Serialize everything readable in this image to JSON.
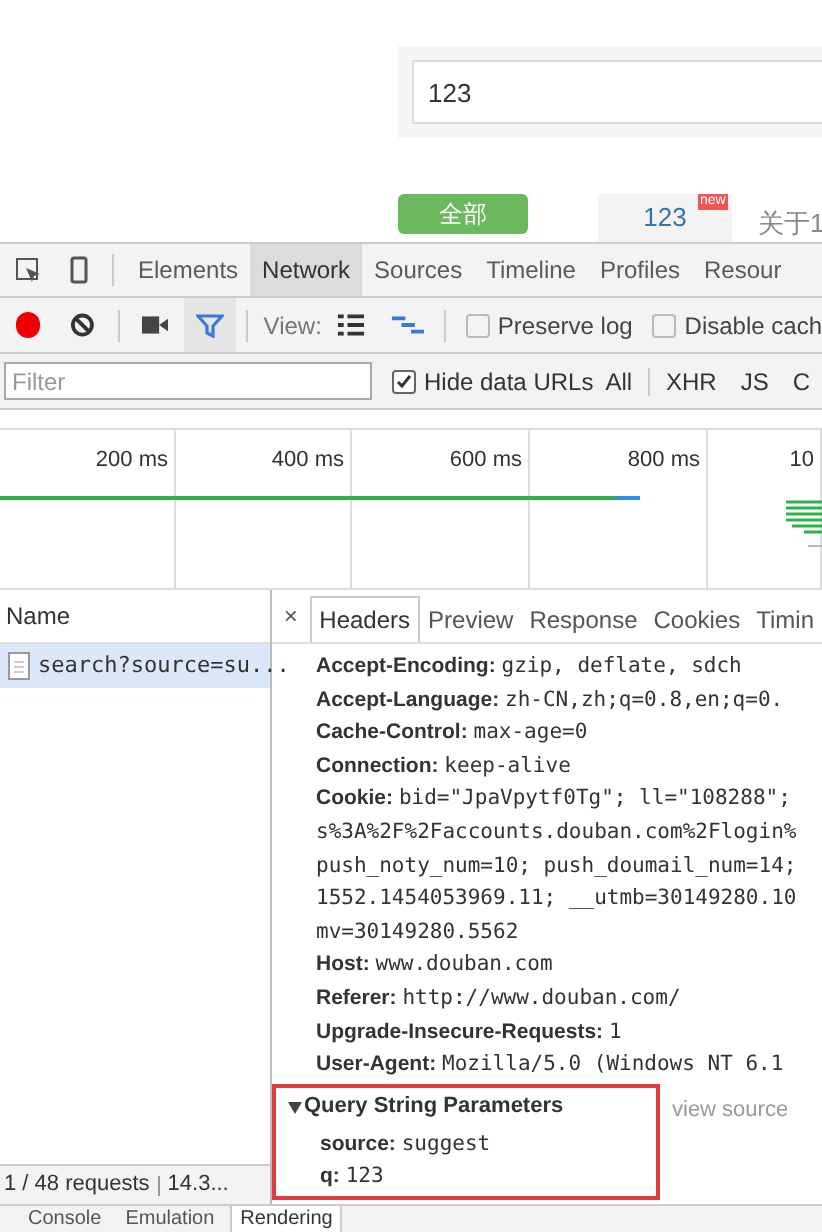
{
  "page": {
    "search_value": "123",
    "filter_button": "全部",
    "suggestion": {
      "text": "123",
      "badge": "new"
    },
    "suggestion_2": "关于1"
  },
  "devtools": {
    "tabs": [
      {
        "label": "Elements",
        "selected": false
      },
      {
        "label": "Network",
        "selected": true
      },
      {
        "label": "Sources",
        "selected": false
      },
      {
        "label": "Timeline",
        "selected": false
      },
      {
        "label": "Profiles",
        "selected": false
      },
      {
        "label": "Resour",
        "selected": false
      }
    ],
    "toolbar": {
      "recording": true,
      "filter_active": true,
      "view_label": "View:",
      "preserve_log": {
        "label": "Preserve log",
        "checked": false
      },
      "disable_cache": {
        "label": "Disable cach",
        "checked": false
      }
    },
    "filter": {
      "placeholder": "Filter",
      "hide_data_urls": {
        "label": "Hide data URLs",
        "checked": true
      },
      "types": [
        {
          "label": "All",
          "selected": false
        },
        {
          "label": "XHR",
          "selected": false
        },
        {
          "label": "JS",
          "selected": false
        },
        {
          "label": "C",
          "selected": false
        }
      ]
    },
    "timeline": {
      "ticks": [
        "200 ms",
        "400 ms",
        "600 ms",
        "800 ms",
        "10"
      ]
    },
    "requests": {
      "column": "Name",
      "rows": [
        {
          "name": "search?source=su...",
          "selected": true
        }
      ]
    },
    "detail_tabs": [
      {
        "label": "×",
        "kind": "close"
      },
      {
        "label": "Headers",
        "kind": "tab",
        "selected": true
      },
      {
        "label": "Preview",
        "kind": "tab",
        "selected": false
      },
      {
        "label": "Response",
        "kind": "tab",
        "selected": false
      },
      {
        "label": "Cookies",
        "kind": "tab",
        "selected": false
      },
      {
        "label": "Timin",
        "kind": "tab",
        "selected": false
      }
    ],
    "headers": [
      {
        "key": "Accept-Encoding:",
        "value": "gzip, deflate, sdch"
      },
      {
        "key": "Accept-Language:",
        "value": "zh-CN,zh;q=0.8,en;q=0."
      },
      {
        "key": "Cache-Control:",
        "value": "max-age=0"
      },
      {
        "key": "Connection:",
        "value": "keep-alive"
      },
      {
        "key": "Cookie:",
        "value": "bid=\"JpaVpytf0Tg\"; ll=\"108288\";"
      },
      {
        "value": "s%3A%2F%2Faccounts.douban.com%2Flogin%"
      },
      {
        "value": "push_noty_num=10; push_doumail_num=14;"
      },
      {
        "value": "1552.1454053969.11; __utmb=30149280.10"
      },
      {
        "value": "mv=30149280.5562"
      },
      {
        "key": "Host:",
        "value": "www.douban.com"
      },
      {
        "key": "Referer:",
        "value": "http://www.douban.com/"
      },
      {
        "key": "Upgrade-Insecure-Requests:",
        "value": "1"
      },
      {
        "key": "User-Agent:",
        "value": "Mozilla/5.0 (Windows NT 6.1"
      }
    ],
    "query": {
      "title": "Query String Parameters",
      "expanded": true,
      "view_source": "view source",
      "params": [
        {
          "key": "source:",
          "value": "suggest"
        },
        {
          "key": "q:",
          "value": "123"
        }
      ]
    },
    "status": {
      "requests": "1 / 48 requests",
      "size": "14.3..."
    },
    "drawer_tabs": [
      {
        "label": "Console",
        "selected": false
      },
      {
        "label": "Emulation",
        "selected": false
      },
      {
        "label": "Rendering",
        "selected": true
      }
    ]
  }
}
